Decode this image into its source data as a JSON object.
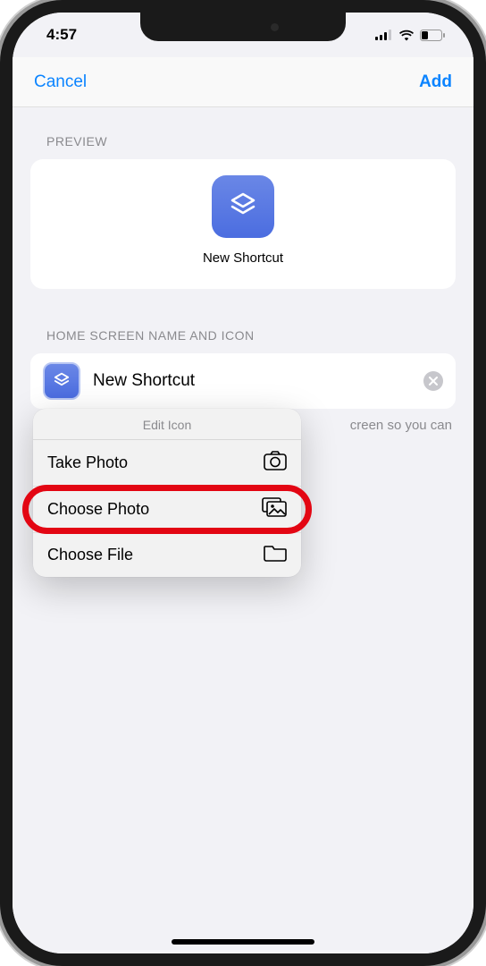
{
  "status": {
    "time": "4:57"
  },
  "nav": {
    "cancel": "Cancel",
    "add": "Add"
  },
  "preview": {
    "header": "PREVIEW",
    "label": "New Shortcut"
  },
  "homescreen": {
    "header": "HOME SCREEN NAME AND ICON",
    "name_value": "New Shortcut",
    "hint_suffix": "creen so you can"
  },
  "popover": {
    "title": "Edit Icon",
    "items": [
      {
        "label": "Take Photo"
      },
      {
        "label": "Choose Photo"
      },
      {
        "label": "Choose File"
      }
    ]
  }
}
